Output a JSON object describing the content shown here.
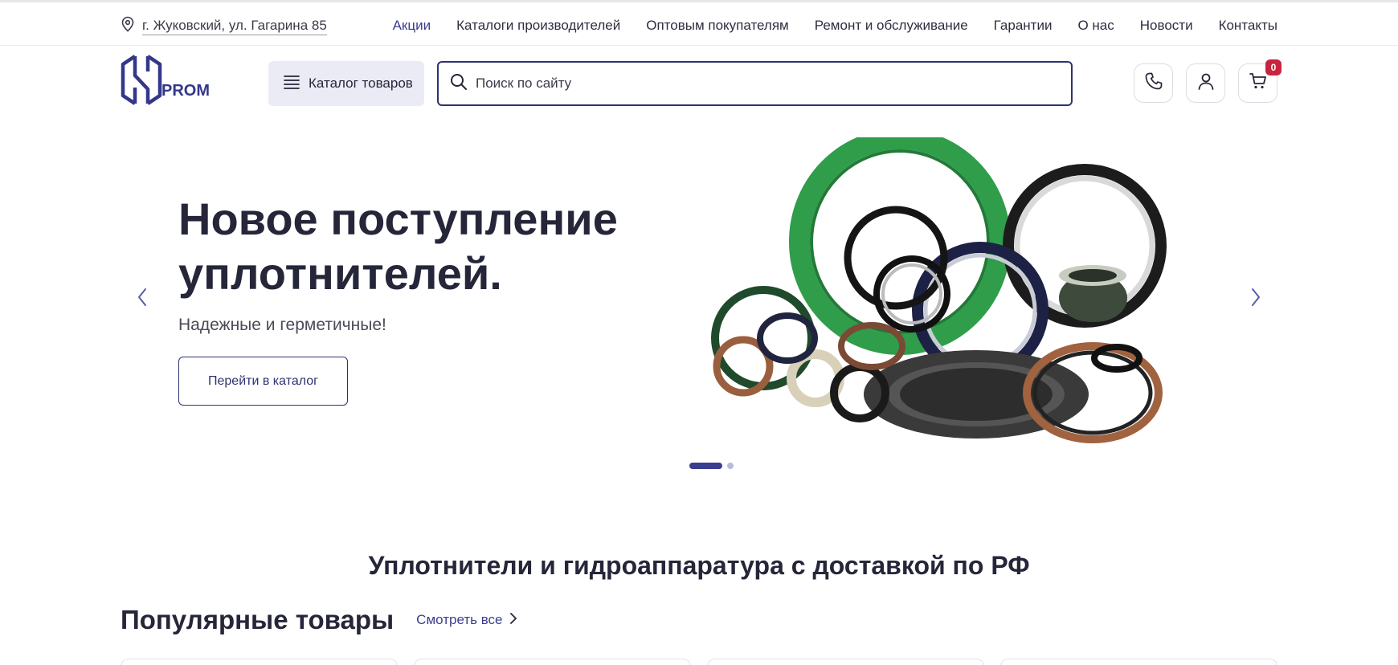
{
  "topbar": {
    "address": "г. Жуковский, ул. Гагарина 85",
    "nav": [
      {
        "label": "Акции",
        "active": true
      },
      {
        "label": "Каталоги производителей"
      },
      {
        "label": "Оптовым покупателям"
      },
      {
        "label": "Ремонт и обслуживание"
      },
      {
        "label": "Гарантии"
      },
      {
        "label": "О нас"
      },
      {
        "label": "Новости"
      },
      {
        "label": "Контакты"
      }
    ]
  },
  "header": {
    "logo_text": "PROM",
    "catalog_label": "Каталог товаров",
    "search_placeholder": "Поиск по сайту",
    "cart_count": "0",
    "icons": [
      "phone-icon",
      "user-icon",
      "cart-icon"
    ]
  },
  "hero": {
    "title": "Новое поступление уплотнителей.",
    "subtitle": "Надежные и герметичные!",
    "button_label": "Перейти в каталог",
    "slides_total": 2,
    "active_slide": 1
  },
  "main": {
    "section_title": "Уплотнители и гидроаппаратура с доставкой по РФ",
    "popular_title": "Популярные товары",
    "see_all_label": "Смотреть все"
  },
  "colors": {
    "accent": "#3b3d8f",
    "badge": "#c8243f",
    "text": "#26263a"
  }
}
